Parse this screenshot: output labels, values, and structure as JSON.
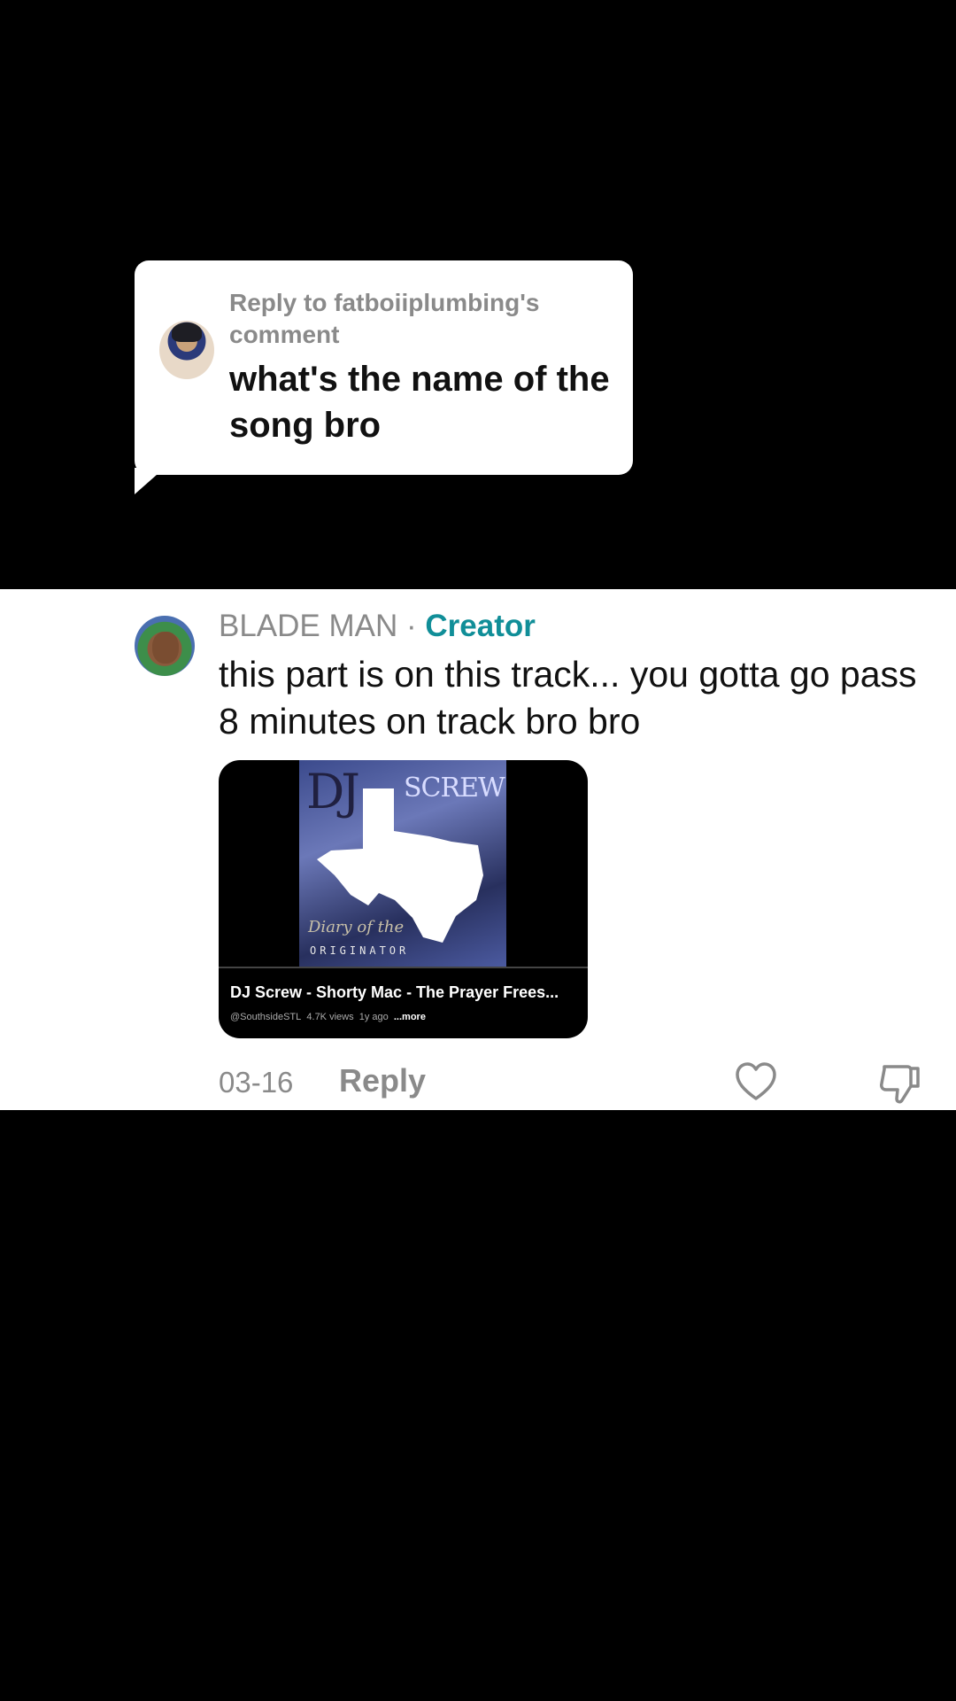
{
  "reply_context": {
    "meta": "Reply to fatboiiplumbing's comment",
    "text": "what's the name of the song bro"
  },
  "comment": {
    "author": "BLADE MAN",
    "separator": "·",
    "badge": "Creator",
    "text": "this part is on this track... you gotta go pass 8 minutes on track bro bro",
    "date": "03-16",
    "reply_label": "Reply"
  },
  "video_card": {
    "thumbnail_text": {
      "dj": "DJ",
      "screw": "SCREW",
      "diary": "Diary of the",
      "originator": "ORIGINATOR"
    },
    "title": "DJ Screw -  Shorty Mac - The Prayer Frees...",
    "channel": "@SouthsideSTL",
    "views": "4.7K views",
    "age": "1y ago",
    "more": "...more"
  },
  "icons": {
    "like": "heart-icon",
    "dislike": "thumbs-down-icon"
  },
  "colors": {
    "creator_badge": "#108e98",
    "muted_text": "#8a8a8a",
    "background": "#000000",
    "panel": "#ffffff"
  }
}
